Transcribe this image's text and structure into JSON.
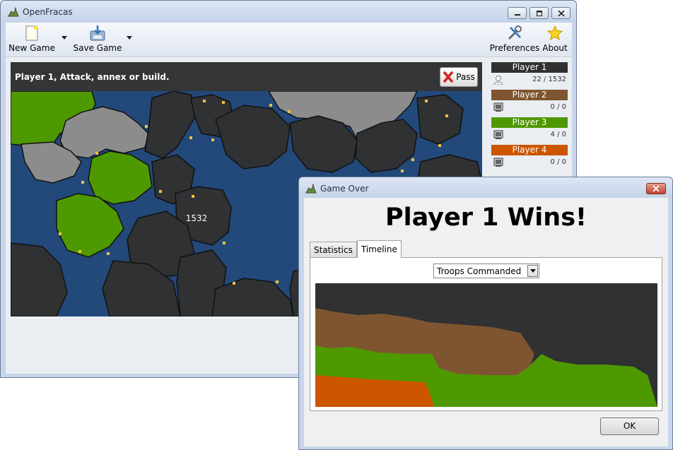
{
  "window": {
    "title": "OpenFracas"
  },
  "toolbar": {
    "new_game": "New Game",
    "save_game": "Save Game",
    "preferences": "Preferences",
    "about": "About"
  },
  "status": {
    "message": "Player 1, Attack, annex or build.",
    "pass_label": "Pass"
  },
  "map": {
    "territory_label": "1532",
    "colors": {
      "sea": "#22497a",
      "neutral": "#2f3133",
      "player1": "#4f9900",
      "grey": "#8c8c8c",
      "border": "#111111",
      "city": "#f0c040"
    }
  },
  "players": [
    {
      "name": "Player 1",
      "color": "#2f3133",
      "count": "22 / 1532",
      "icon": "person-icon"
    },
    {
      "name": "Player 2",
      "color": "#7e5530",
      "count": "0 / 0",
      "icon": "computer-icon"
    },
    {
      "name": "Player 3",
      "color": "#4f9900",
      "count": "4 / 0",
      "icon": "computer-icon"
    },
    {
      "name": "Player 4",
      "color": "#cc5500",
      "count": "0 / 0",
      "icon": "computer-icon"
    }
  ],
  "dialog": {
    "title": "Game Over",
    "winner_text": "Player 1 Wins!",
    "tabs": [
      "Statistics",
      "Timeline"
    ],
    "active_tab": "Timeline",
    "metric_select": "Troops Commanded",
    "ok_label": "OK"
  },
  "chart_data": {
    "type": "area",
    "stacked": true,
    "series_colors": [
      "#cc5500",
      "#4f9900",
      "#7e5530",
      "#2f3133"
    ]
  }
}
